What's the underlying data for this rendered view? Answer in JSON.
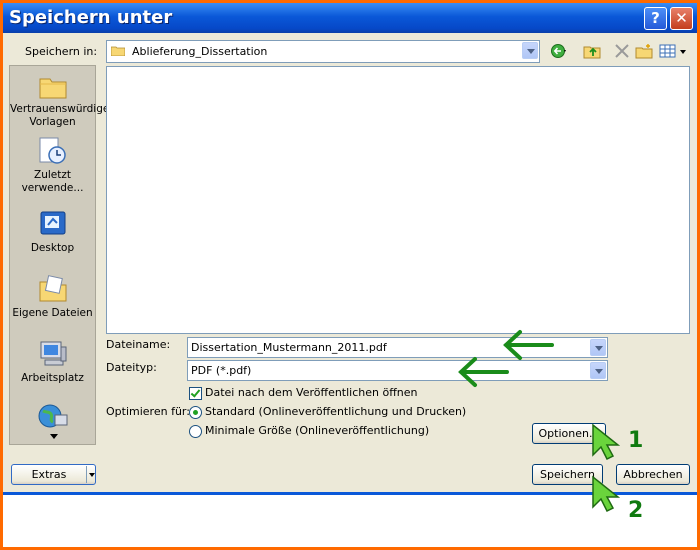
{
  "window": {
    "title": "Speichern unter",
    "help_glyph": "?",
    "close_glyph": "✕"
  },
  "toolbar": {
    "save_in_label": "Speichern in:",
    "save_in_value": "Ablieferung_Dissertation",
    "icons": [
      "back-icon",
      "up-folder-icon",
      "delete-icon",
      "new-folder-icon",
      "view-menu-icon"
    ]
  },
  "places": {
    "items": [
      {
        "label": "Vertrauenswürdige Vorlagen",
        "icon": "folder-icon"
      },
      {
        "label": "Zuletzt verwende...",
        "icon": "recent-icon"
      },
      {
        "label": "Desktop",
        "icon": "desktop-icon"
      },
      {
        "label": "Eigene Dateien",
        "icon": "my-documents-icon"
      },
      {
        "label": "Arbeitsplatz",
        "icon": "my-computer-icon"
      },
      {
        "label": "",
        "icon": "network-icon"
      }
    ]
  },
  "form": {
    "filename_label": "Dateiname:",
    "filename_value": "Dissertation_Mustermann_2011.pdf",
    "filetype_label": "Dateityp:",
    "filetype_value": "PDF (*.pdf)",
    "open_after_label": "Datei nach dem Veröffentlichen öffnen",
    "open_after_checked": true,
    "optimize_label": "Optimieren für:",
    "optimize_options": [
      {
        "label": "Standard (Onlineveröffentlichung und Drucken)",
        "selected": true
      },
      {
        "label": "Minimale Größe (Onlineveröffentlichung)",
        "selected": false
      }
    ]
  },
  "buttons": {
    "options": "Optionen...",
    "save": "Speichern",
    "cancel": "Abbrechen",
    "extras": "Extras"
  },
  "annotations": {
    "step1": "1",
    "step2": "2",
    "arrow_color": "#1a8c1a"
  },
  "colors": {
    "title_bar": "#0a58d8",
    "frame": "#ff6a00",
    "dialog_bg": "#ece9d8"
  }
}
